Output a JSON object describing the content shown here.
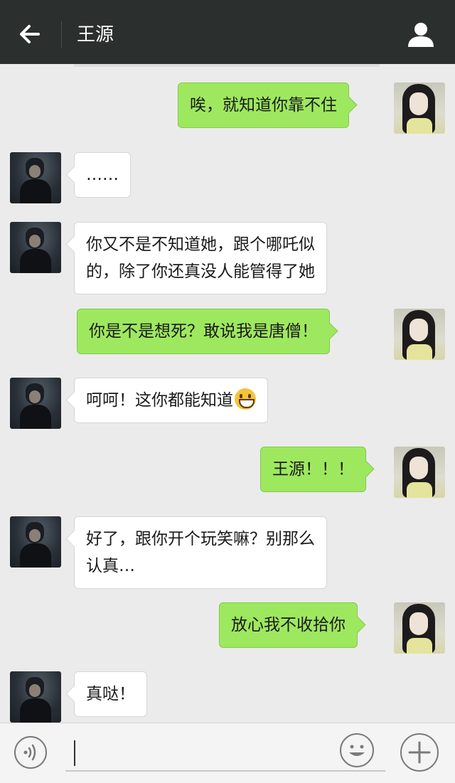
{
  "header": {
    "title": "王源",
    "back_icon": "arrow-left-icon",
    "profile_icon": "person-icon",
    "background": "#2b2f2e"
  },
  "chat": {
    "messages": [
      {
        "side": "right",
        "lines": [
          "唉，就知道你靠不住"
        ]
      },
      {
        "side": "left",
        "lines": [
          "……"
        ]
      },
      {
        "side": "left",
        "lines": [
          "你又不是不知道她，跟个哪吒似",
          "的，除了你还真没人能管得了她"
        ]
      },
      {
        "side": "right",
        "lines": [
          "你是不是想死？敢说我是唐僧！"
        ]
      },
      {
        "side": "left",
        "lines": [
          "呵呵！这你都能知道"
        ],
        "emoji": "grinning-face-emoji"
      },
      {
        "side": "right",
        "lines": [
          "王源！！！"
        ]
      },
      {
        "side": "left",
        "lines": [
          "好了，跟你开个玩笑嘛？别那么",
          "认真…"
        ]
      },
      {
        "side": "right",
        "lines": [
          "放心我不收拾你"
        ]
      },
      {
        "side": "left",
        "lines": [
          "真哒！"
        ]
      }
    ],
    "colors": {
      "sent": "#9ee85f",
      "received": "#ffffff",
      "background": "#ebebeb"
    }
  },
  "inputbar": {
    "voice_icon": "voice-icon",
    "emoji_icon": "smiley-icon",
    "plus_icon": "plus-icon",
    "value": ""
  }
}
